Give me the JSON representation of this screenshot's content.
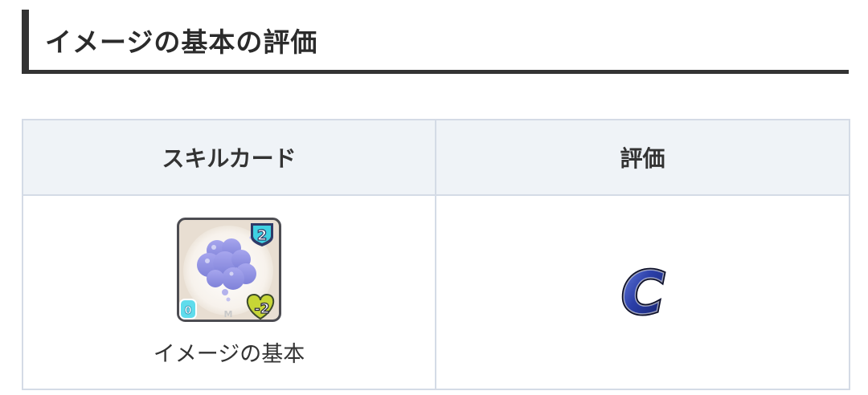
{
  "section": {
    "title": "イメージの基本の評価"
  },
  "table": {
    "headers": [
      "スキルカード",
      "評価"
    ],
    "rows": [
      {
        "card_name": "イメージの基本",
        "card_icon": {
          "icon": "lavender-clouds-skill-card-icon",
          "cost": "2",
          "stamina": "-2",
          "corner_mark": "M"
        },
        "grade": {
          "icon": "grade-c-icon",
          "letter": "C"
        }
      }
    ]
  },
  "colors": {
    "heading_bar": "#333333",
    "header_bg": "#eff3f7",
    "border": "#d4dbe6",
    "grade_blue": "#1c2f8a"
  }
}
